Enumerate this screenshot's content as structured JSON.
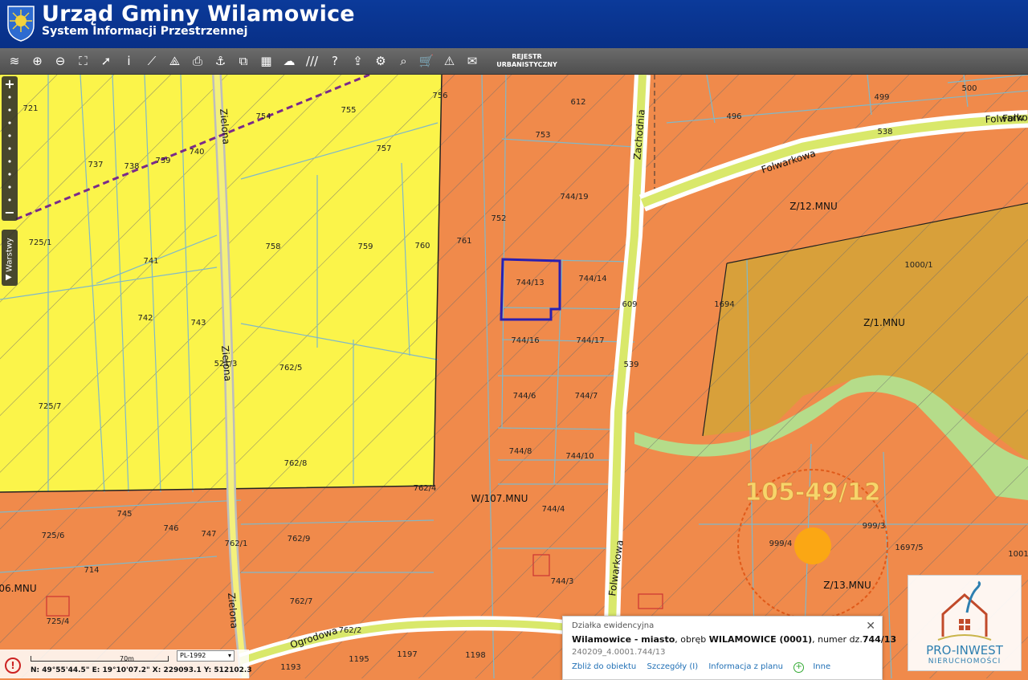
{
  "header": {
    "title": "Urząd Gminy Wilamowice",
    "subtitle": "System Informacji Przestrzennej"
  },
  "toolbar": {
    "tools": [
      {
        "name": "layers-icon",
        "glyph": "≋"
      },
      {
        "name": "zoom-in-icon",
        "glyph": "⊕"
      },
      {
        "name": "zoom-out-icon",
        "glyph": "⊖"
      },
      {
        "name": "zoom-extent-icon",
        "glyph": "⛶"
      },
      {
        "name": "pointer-icon",
        "glyph": "➚"
      },
      {
        "name": "info-icon",
        "glyph": "i"
      },
      {
        "name": "measure-line-icon",
        "glyph": "⟋"
      },
      {
        "name": "measure-area-icon",
        "glyph": "⟁"
      },
      {
        "name": "print-icon",
        "glyph": "⎙"
      },
      {
        "name": "anchor-icon",
        "glyph": "⚓"
      },
      {
        "name": "copy-icon",
        "glyph": "⧉"
      },
      {
        "name": "layout-icon",
        "glyph": "▦"
      },
      {
        "name": "comment-icon",
        "glyph": "☁"
      },
      {
        "name": "hatch-icon",
        "glyph": "///"
      },
      {
        "name": "help-icon",
        "glyph": "?"
      },
      {
        "name": "upload-icon",
        "glyph": "⇪"
      },
      {
        "name": "settings-icon",
        "glyph": "⚙"
      },
      {
        "name": "search-icon",
        "glyph": "⌕"
      },
      {
        "name": "cart-icon",
        "glyph": "🛒"
      },
      {
        "name": "warning-icon",
        "glyph": "⚠"
      },
      {
        "name": "chat-icon",
        "glyph": "✉"
      }
    ],
    "registry_label": "REJESTR URBANISTYCZNY"
  },
  "map": {
    "parcels": [
      "721",
      "754",
      "755",
      "756",
      "612",
      "753",
      "737",
      "738",
      "739",
      "740",
      "757",
      "744/19",
      "752",
      "761",
      "725/1",
      "741",
      "758",
      "759",
      "760",
      "744/13",
      "744/14",
      "609",
      "742",
      "743",
      "744/16",
      "744/17",
      "539",
      "521/3",
      "762/5",
      "725/7",
      "744/6",
      "744/7",
      "744/8",
      "744/10",
      "762/8",
      "762/4",
      "744/4",
      "745",
      "725/6",
      "746",
      "747",
      "762/9",
      "762/1",
      "714",
      "744/3",
      "762/7",
      "725/4",
      "762/2",
      "1193",
      "1195",
      "1197",
      "1198",
      "499",
      "500",
      "496",
      "538",
      "1000/1",
      "1694",
      "999/3",
      "999/4",
      "1697/5",
      "1001"
    ],
    "streets": [
      "Zielona",
      "Zielona",
      "Zielona",
      "Zachodnia",
      "Folwarkowa",
      "Folwarkowa",
      "Folwarkowa",
      "Ogrodowa",
      "Folw"
    ],
    "zones": [
      "W/107.MNU",
      "Z/12.MNU",
      "Z/1.MNU",
      "Z/13.MNU",
      "06.MNU"
    ],
    "point_label": "105-49/12"
  },
  "statusbar": {
    "scale": "70m",
    "projection": "PL-1992",
    "coords": "N: 49°55'44.5\"  E: 19°10'07.2\"  X: 229093.1   Y: 512102.3"
  },
  "sidebar": {
    "layers_tab": "Warstwy"
  },
  "popup": {
    "title": "Działka ewidencyjna",
    "place": "Wilamowice - miasto",
    "text1": ", obręb ",
    "precinct": "WILAMOWICE (0001)",
    "text2": ", numer dz.",
    "parcel": "744/13",
    "id": "240209_4.0001.744/13",
    "links": [
      "Zbliż do obiektu",
      "Szczegóły (I)",
      "Informacja z planu",
      "Inne"
    ]
  },
  "logo": {
    "name": "PRO-INWEST",
    "sub": "NIERUCHOMOŚCI"
  },
  "colors": {
    "header": "#0b3a9a",
    "residential": "#f08a4b",
    "agricultural": "#ffff4d",
    "green": "#b5dc8a",
    "brown": "#d6a33a",
    "selection": "#2a1fb0"
  }
}
